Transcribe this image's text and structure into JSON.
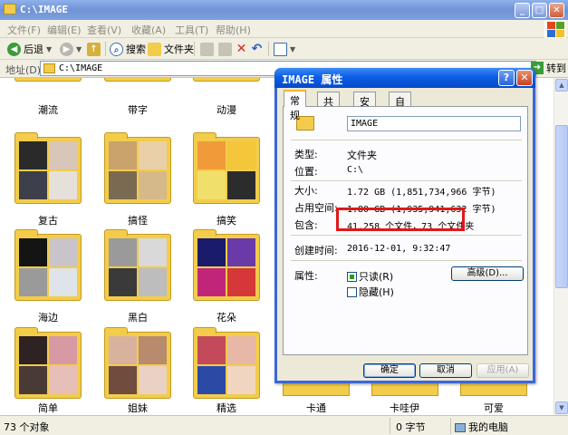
{
  "window": {
    "title": "C:\\IMAGE",
    "min": "_",
    "max": "□",
    "close": "✕"
  },
  "menu": [
    "文件(F)",
    "编辑(E)",
    "查看(V)",
    "收藏(A)",
    "工具(T)",
    "帮助(H)"
  ],
  "toolbar": {
    "back": "后退",
    "search": "搜索",
    "folders": "文件夹"
  },
  "address": {
    "label": "地址(D)",
    "path": "C:\\IMAGE",
    "go": "转到"
  },
  "folders_top": [
    "潮流",
    "带字",
    "动漫"
  ],
  "folders": [
    {
      "name": "复古",
      "colors": [
        "#2a2a2a",
        "#d8c6b8",
        "#3d3f4a",
        "#e6e0da"
      ]
    },
    {
      "name": "搞怪",
      "colors": [
        "#c9a36b",
        "#e9d0a9",
        "#7b6a52",
        "#d6b98a"
      ]
    },
    {
      "name": "搞笑",
      "colors": [
        "#f19a3a",
        "#f3c63b",
        "#f0e06b",
        "#2c2c2c"
      ]
    },
    {
      "name": "海边",
      "colors": [
        "#141414",
        "#c8c4c9",
        "#9a9a9a",
        "#dfe4ea"
      ]
    },
    {
      "name": "黑白",
      "colors": [
        "#9a9a9a",
        "#d9d9d9",
        "#3a3a3a",
        "#bdbdbd"
      ]
    },
    {
      "name": "花朵",
      "colors": [
        "#1b1b6b",
        "#6a3aa8",
        "#c0257a",
        "#d43838"
      ]
    },
    {
      "name": "简单",
      "colors": [
        "#2f2222",
        "#d79aa5",
        "#4a3a36",
        "#e6c0b8"
      ]
    },
    {
      "name": "姐妹",
      "colors": [
        "#d8b29d",
        "#b88a6e",
        "#6f4c3d",
        "#e9d2c3"
      ]
    },
    {
      "name": "精选",
      "colors": [
        "#c34a5a",
        "#e7b7a8",
        "#2a4aa6",
        "#f0d6c0"
      ]
    }
  ],
  "folders_peek": [
    "卡通",
    "卡哇伊",
    "可爱"
  ],
  "status": {
    "objects": "73 个对象",
    "size": "0 字节",
    "location": "我的电脑"
  },
  "dialog": {
    "title": "IMAGE 属性",
    "help": "?",
    "close": "✕",
    "tabs": [
      "常规",
      "共享",
      "安全",
      "自定义"
    ],
    "name": "IMAGE",
    "rows": [
      {
        "label": "类型:",
        "value": "文件夹"
      },
      {
        "label": "位置:",
        "value": "C:\\"
      },
      {
        "label": "大小:",
        "value": "1.72 GB (1,851,734,966 字节)"
      },
      {
        "label": "占用空间:",
        "value": "1.80 GB (1,935,941,632 字节)"
      },
      {
        "label": "包含:",
        "value": "41,258 个文件，73 个文件夹"
      },
      {
        "label": "创建时间:",
        "value": "2016-12-01, 9:32:47"
      }
    ],
    "attributes_label": "属性:",
    "readonly": "只读(R)",
    "hidden": "隐藏(H)",
    "advanced": "高级(D)...",
    "ok": "确定",
    "cancel": "取消",
    "apply": "应用(A)"
  }
}
